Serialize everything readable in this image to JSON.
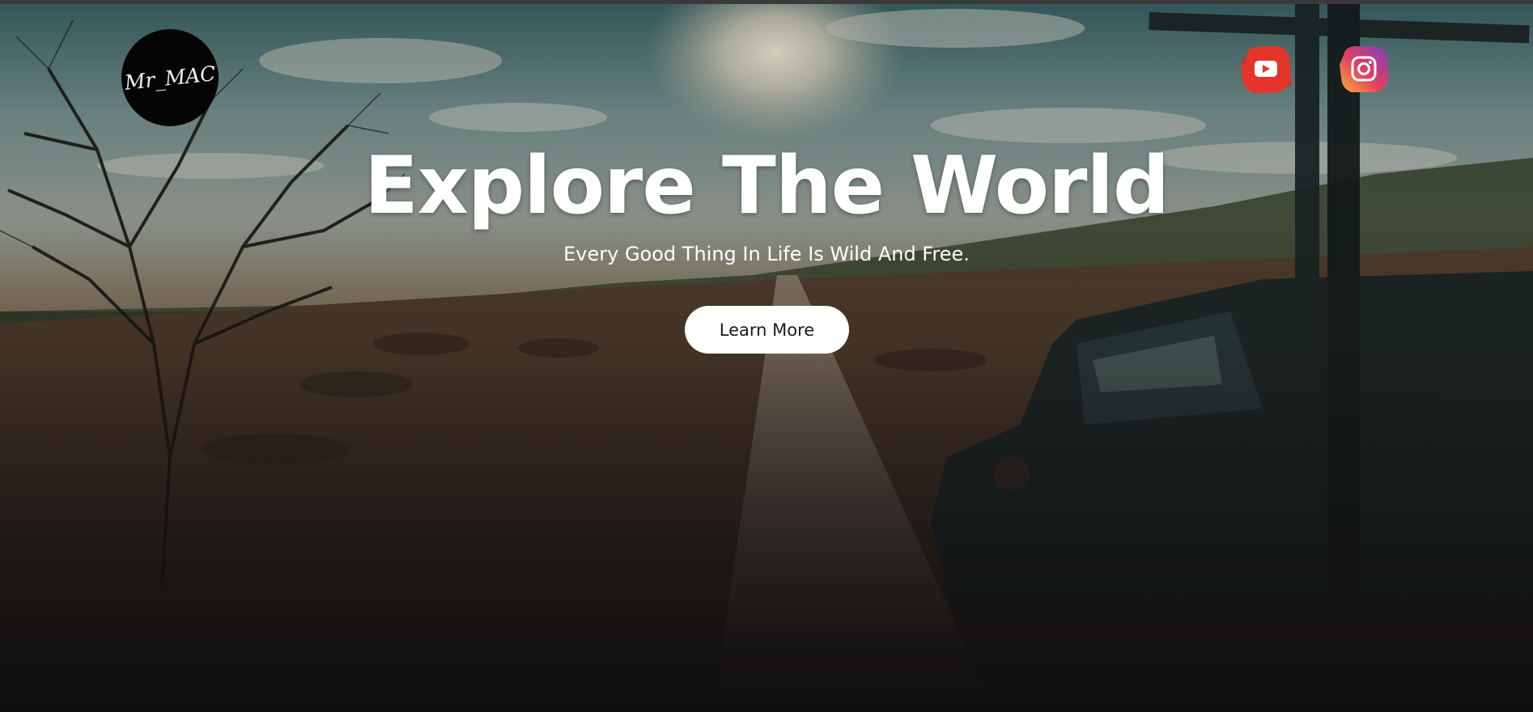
{
  "brand": {
    "logo_text": "Mr_MAC"
  },
  "social": {
    "youtube": {
      "icon": "youtube-icon",
      "color": "#e8342c"
    },
    "instagram": {
      "icon": "instagram-icon",
      "color": "#c13584"
    }
  },
  "hero": {
    "title": "Explore The World",
    "subtitle": "Every Good Thing In Life Is Wild And Free.",
    "cta_label": "Learn More",
    "background": "savanna-road-safari-jeep-photo"
  },
  "colors": {
    "page_bg": "#141313",
    "text": "#ffffff",
    "button_bg": "#ffffff",
    "button_text": "#1b1b1b"
  }
}
